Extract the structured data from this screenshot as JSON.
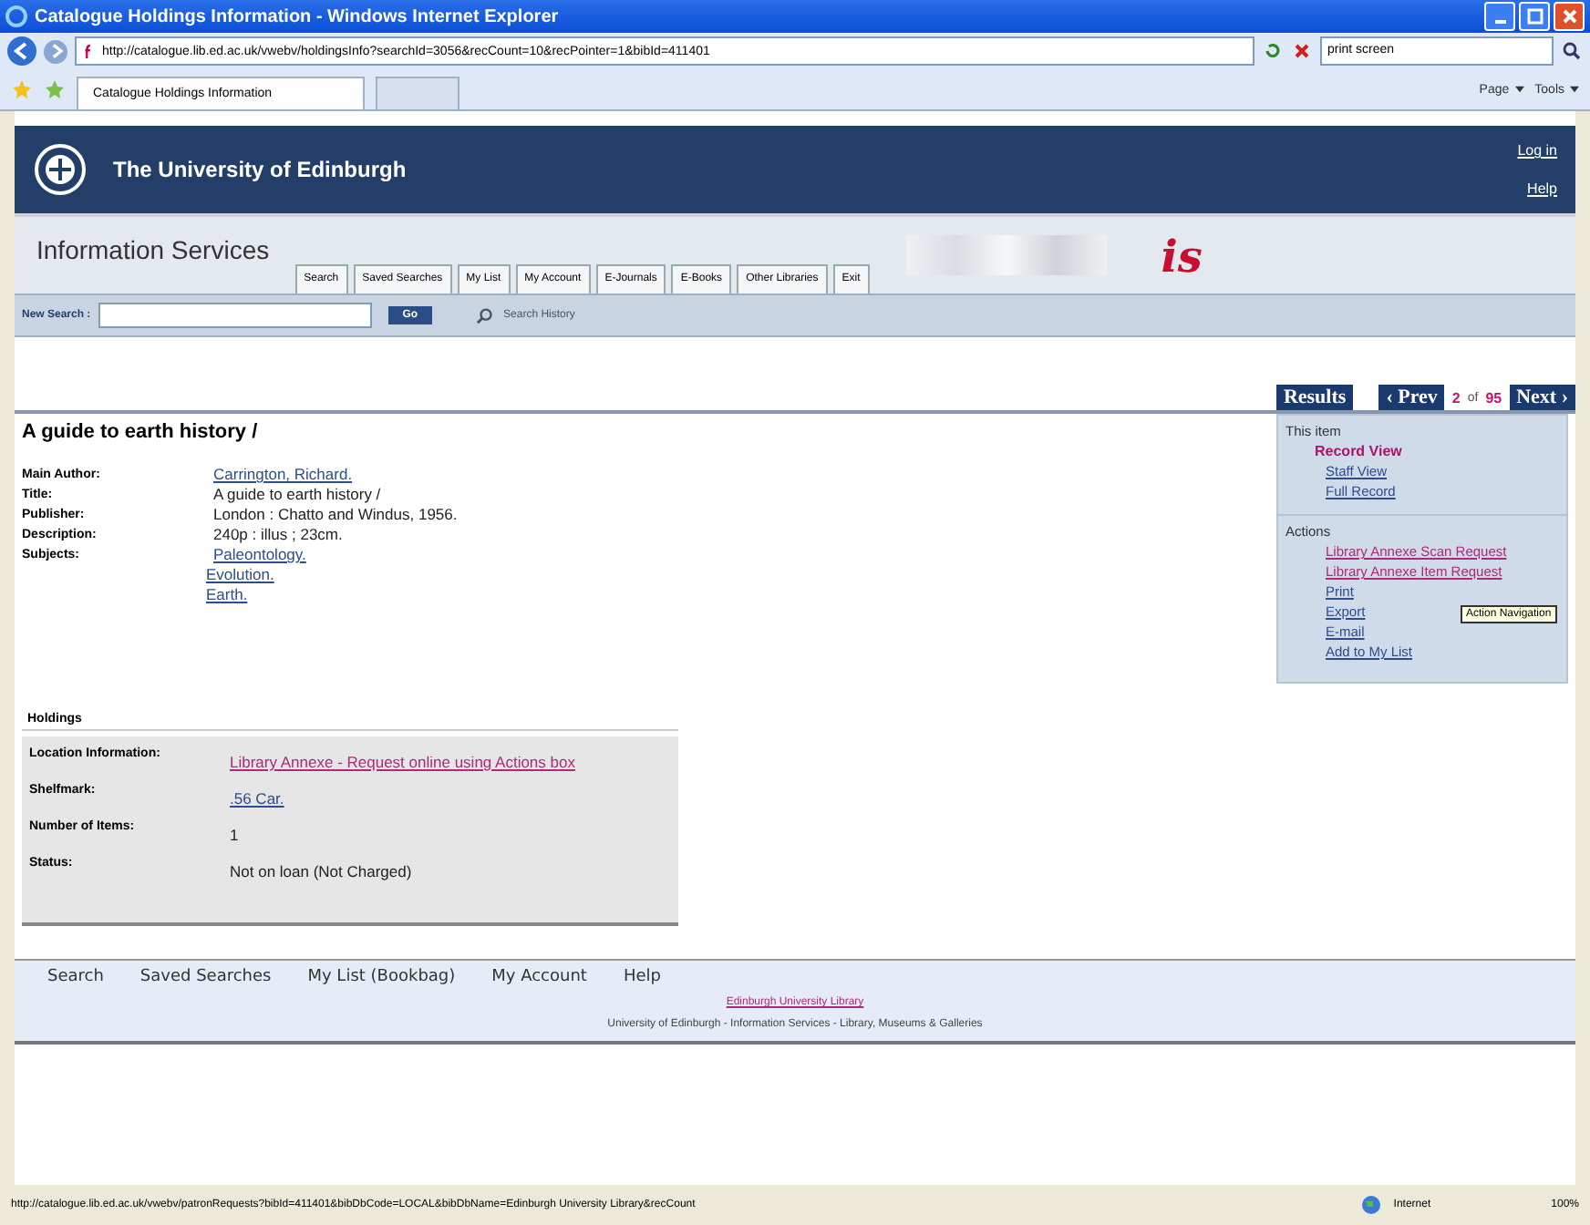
{
  "window": {
    "title": "Catalogue Holdings Information - Windows Internet Explorer"
  },
  "address": {
    "url": "http://catalogue.lib.ed.ac.uk/vwebv/holdingsInfo?searchId=3056&recCount=10&recPointer=1&bibId=411401"
  },
  "browser_search": {
    "value": "print screen"
  },
  "browser_tabs": [
    {
      "label": "Catalogue Holdings Information",
      "selected": true
    },
    {
      "selected": false
    }
  ],
  "browser_toolbar": [
    "Page",
    "Tools"
  ],
  "header": {
    "title": "The University of Edinburgh",
    "links": [
      "Log in",
      "Help"
    ]
  },
  "service": {
    "title": "Information Services",
    "logo": "is",
    "tabs": [
      "Search",
      "Saved Searches",
      "My List",
      "My Account",
      "E-Journals",
      "E-Books",
      "Other Libraries",
      "Exit"
    ]
  },
  "new_search": {
    "label": "New Search :",
    "button": "Go",
    "history": "Search History"
  },
  "pager": {
    "results": "Results",
    "prev": "‹ Prev",
    "current": "2",
    "of": "of",
    "total": "95",
    "next": "Next ›"
  },
  "record": {
    "heading": "A guide to earth history /",
    "fields": [
      {
        "label": "Main Author:",
        "values": [
          {
            "text": "Carrington, Richard.",
            "kind": "link"
          }
        ]
      },
      {
        "label": "Title:",
        "values": [
          {
            "text": "A guide to earth history /",
            "kind": "text"
          }
        ]
      },
      {
        "label": "Publisher:",
        "values": [
          {
            "text": "London : Chatto and Windus, 1956.",
            "kind": "text"
          }
        ]
      },
      {
        "label": "Description:",
        "values": [
          {
            "text": "240p : illus ; 23cm.",
            "kind": "text"
          }
        ]
      },
      {
        "label": "Subjects:",
        "values": [
          {
            "text": "Paleontology.",
            "kind": "link"
          },
          {
            "text": "Evolution.",
            "kind": "link"
          },
          {
            "text": "Earth.",
            "kind": "link"
          }
        ]
      }
    ]
  },
  "sidebar": {
    "item_heading": "This item",
    "views": [
      {
        "label": "Record View",
        "selected": true
      },
      {
        "label": "Staff View",
        "selected": false
      },
      {
        "label": "Full Record",
        "selected": false
      }
    ],
    "actions_heading": "Actions",
    "actions": [
      {
        "label": "Library Annexe Scan Request",
        "visited": true
      },
      {
        "label": "Library Annexe Item Request",
        "visited": true
      },
      {
        "label": "Print",
        "visited": false
      },
      {
        "label": "Export",
        "visited": false
      },
      {
        "label": "E-mail",
        "visited": false
      },
      {
        "label": "Add to My List",
        "visited": false
      }
    ]
  },
  "tooltip": "Action Navigation",
  "holdings": {
    "heading": "Holdings",
    "fields": [
      {
        "label": "Location Information:",
        "value": "Library Annexe - Request online using Actions box",
        "kind": "visited"
      },
      {
        "label": "Shelfmark:",
        "value": ".56 Car.",
        "kind": "link"
      },
      {
        "label": "Number of Items:",
        "value": "1",
        "kind": "text"
      },
      {
        "label": "Status:",
        "value": "Not on loan (Not Charged)",
        "kind": "text"
      }
    ]
  },
  "footer": {
    "links": [
      "Search",
      "Saved Searches",
      "My List (Bookbag)",
      "My Account",
      "Help"
    ],
    "library": "Edinburgh University Library",
    "credit": "University of Edinburgh - Information Services - Library, Museums & Galleries"
  },
  "status_bar": {
    "url": "http://catalogue.lib.ed.ac.uk/vwebv/patronRequests?bibId=411401&bibDbCode=LOCAL&bibDbName=Edinburgh University Library&recCount",
    "zone": "Internet",
    "zoom": "100%"
  }
}
